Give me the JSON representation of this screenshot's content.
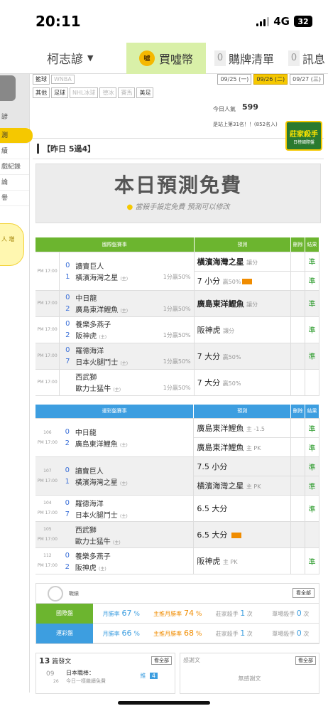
{
  "status": {
    "time": "20:11",
    "network": "4G",
    "battery": "32"
  },
  "nav": {
    "user": "柯志諺",
    "buy": "買噓幣",
    "cart_count": "0",
    "cart": "購牌清單",
    "msg_count": "0",
    "msg": "訊息"
  },
  "sidebar": {
    "items": [
      "諺",
      "測",
      "績",
      "戲紀錄",
      "論",
      "譽"
    ],
    "bulb_text": "人 增"
  },
  "filters": {
    "row1": [
      "籃球",
      "WNBA"
    ],
    "row2": [
      "其他",
      "足球",
      "NHL冰球",
      "德冰",
      "賽馬",
      "美足"
    ],
    "dates": [
      "09/25 (一)",
      "09/26 (二)",
      "09/27 (三)"
    ]
  },
  "popular": {
    "label": "今日人氣",
    "value": "599",
    "rank": "是站上第31名！！(852名入)"
  },
  "badge": {
    "title": "莊家殺手",
    "sub": "日榜國際盤"
  },
  "yesterday": "【昨日 5過4】",
  "promo": {
    "title": "本日預測免費",
    "sub": "當殺手設定免費 預測可以修改"
  },
  "intl": {
    "headers": [
      "國際盤賽事",
      "預測",
      "刪除",
      "結果"
    ],
    "games": [
      {
        "time": "PM 17:00",
        "s1": "0",
        "t1": "讀賣巨人",
        "s2": "1",
        "t2": "橫濱海灣之星",
        "odds": "1分贏50%",
        "preds": [
          {
            "text": "橫濱海灣之星",
            "note": "讓分",
            "bold": true,
            "result": "準"
          },
          {
            "text": "7 小分",
            "note": "贏50%",
            "hot": true,
            "result": "準"
          }
        ]
      },
      {
        "time": "PM 17:00",
        "s1": "0",
        "t1": "中日龍",
        "s2": "2",
        "t2": "廣島東洋鯉魚",
        "odds": "1分贏50%",
        "preds": [
          {
            "text": "廣島東洋鯉魚",
            "note": "讓分",
            "bold": true,
            "result": "準"
          }
        ]
      },
      {
        "time": "PM 17:00",
        "s1": "0",
        "t1": "養樂多燕子",
        "s2": "2",
        "t2": "阪神虎",
        "odds": "1分贏50%",
        "preds": [
          {
            "text": "阪神虎",
            "note": "讓分",
            "result": "準"
          }
        ]
      },
      {
        "time": "PM 17:00",
        "s1": "0",
        "t1": "羅德海洋",
        "s2": "7",
        "t2": "日本火腿鬥士",
        "odds": "1分贏50%",
        "preds": [
          {
            "text": "7 大分",
            "note": "贏50%",
            "result": "準"
          }
        ]
      },
      {
        "time": "PM 17:00",
        "s1": "",
        "t1": "西武獅",
        "s2": "",
        "t2": "歐力士猛牛",
        "odds": "1分贏50%",
        "preds": [
          {
            "text": "7 大分",
            "note": "贏50%",
            "result": ""
          }
        ]
      }
    ]
  },
  "lottery": {
    "headers": [
      "運彩盤賽事",
      "預測",
      "刪除",
      "結果"
    ],
    "games": [
      {
        "code": "106",
        "time": "PM 17:00",
        "s1": "0",
        "t1": "中日龍",
        "s2": "2",
        "t2": "廣島東洋鯉魚",
        "preds": [
          {
            "text": "廣島東洋鯉魚",
            "note": "主 -1.5",
            "result": "準"
          },
          {
            "text": "廣島東洋鯉魚",
            "note": "主 PK",
            "result": "準"
          }
        ]
      },
      {
        "code": "107",
        "time": "PM 17:00",
        "s1": "0",
        "t1": "讀賣巨人",
        "s2": "1",
        "t2": "橫濱海灣之星",
        "preds": [
          {
            "text": "7.5 小分",
            "note": "",
            "result": "準"
          },
          {
            "text": "橫濱海灣之星",
            "note": "主 PK",
            "result": "準"
          }
        ]
      },
      {
        "code": "104",
        "time": "PM 17:00",
        "s1": "0",
        "t1": "羅德海洋",
        "s2": "7",
        "t2": "日本火腿鬥士",
        "preds": [
          {
            "text": "6.5 大分",
            "note": "",
            "result": "準"
          }
        ]
      },
      {
        "code": "105",
        "time": "PM 17:00",
        "s1": "",
        "t1": "西武獅",
        "s2": "",
        "t2": "歐力士猛牛",
        "preds": [
          {
            "text": "6.5 大分",
            "note": "",
            "hot": true,
            "result": ""
          }
        ]
      },
      {
        "code": "112",
        "time": "PM 17:00",
        "s1": "0",
        "t1": "養樂多燕子",
        "s2": "2",
        "t2": "阪神虎",
        "preds": [
          {
            "text": "阪神虎",
            "note": "主 PK",
            "result": "準"
          }
        ]
      }
    ]
  },
  "stats": {
    "title": "戰績",
    "see_all": "看全部",
    "rows": [
      {
        "label": "國際盤",
        "month": "67",
        "main": "74",
        "killer": "1",
        "single": "0"
      },
      {
        "label": "運彩盤",
        "month": "66",
        "main": "68",
        "killer": "1",
        "single": "0"
      }
    ],
    "month_lbl": "月勝率",
    "main_lbl": "主推月勝率",
    "killer_lbl": "莊家殺手",
    "single_lbl": "單場殺手",
    "unit": "次",
    "pct": "%"
  },
  "posts": {
    "count": "13",
    "label": "篇發文",
    "see_all": "看全部",
    "month": "09",
    "day": "26",
    "title": "日本職棒：",
    "subtitle": "今日一樣繼續免費",
    "push_lbl": "推",
    "push": "4"
  },
  "thanks": {
    "label": "感謝文",
    "see_all": "看全部",
    "empty": "無感謝文"
  },
  "colors": {
    "green": "#6cb52f",
    "blue": "#3d9ee0",
    "yellow": "#f5c800",
    "orange": "#f08c00"
  }
}
